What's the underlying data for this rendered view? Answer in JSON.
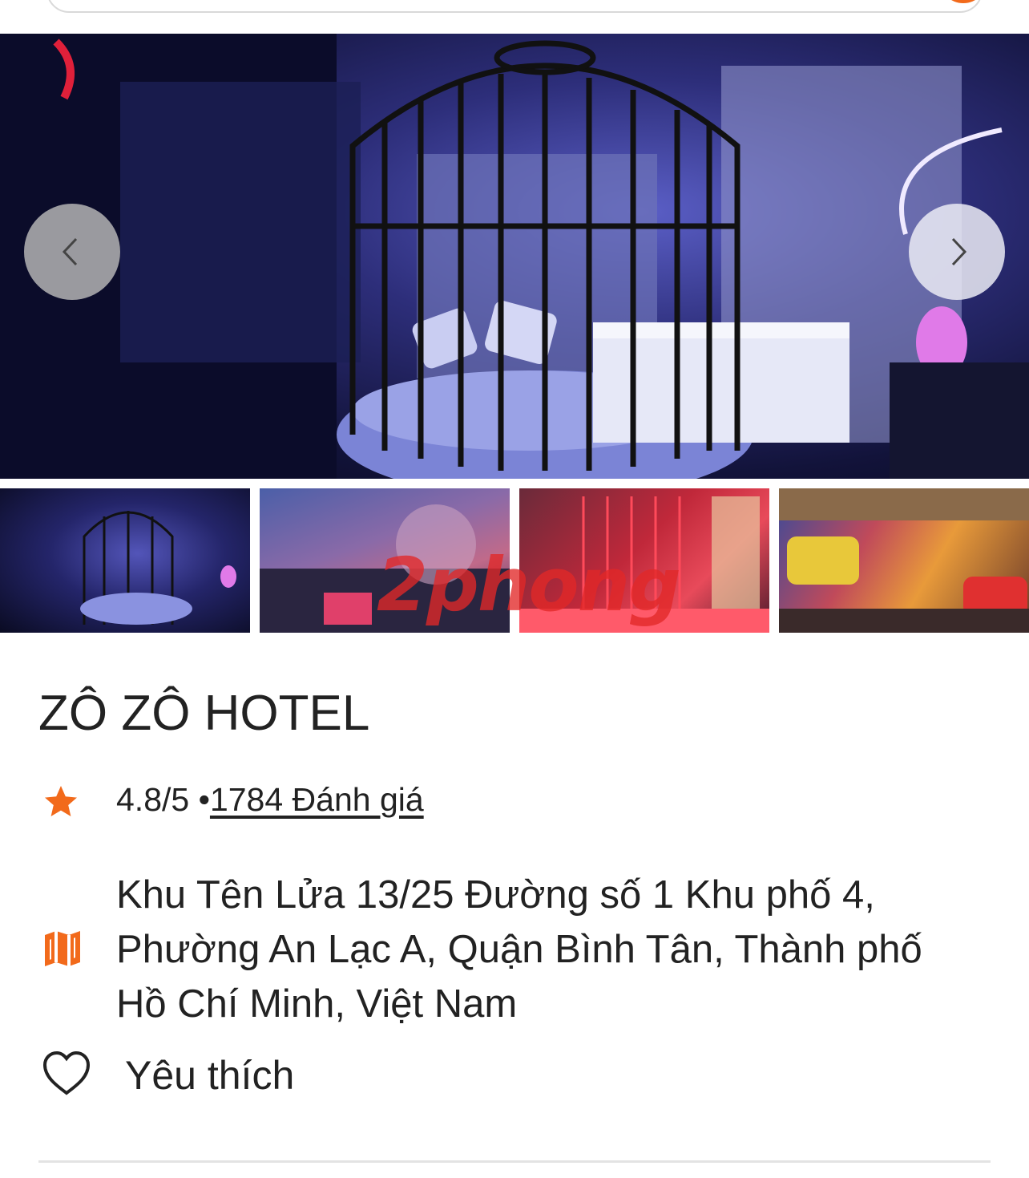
{
  "hotel": {
    "name": "ZÔ ZÔ HOTEL",
    "rating": "4.8/5 •",
    "reviews": "1784 Đánh giá",
    "address": "Khu Tên Lửa 13/25 Đường số 1 Khu phố 4, Phường An Lạc A, Quận Bình Tân, Thành phố Hồ Chí Minh, Việt Nam",
    "favorite_label": "Yêu thích"
  },
  "gallery": {
    "watermark": "2phong",
    "prev_icon": "chevron-left-icon",
    "next_icon": "chevron-right-icon",
    "thumbnail_count": 4
  },
  "colors": {
    "accent": "#f26a1b",
    "text": "#222222",
    "divider": "#e3e3e3"
  }
}
